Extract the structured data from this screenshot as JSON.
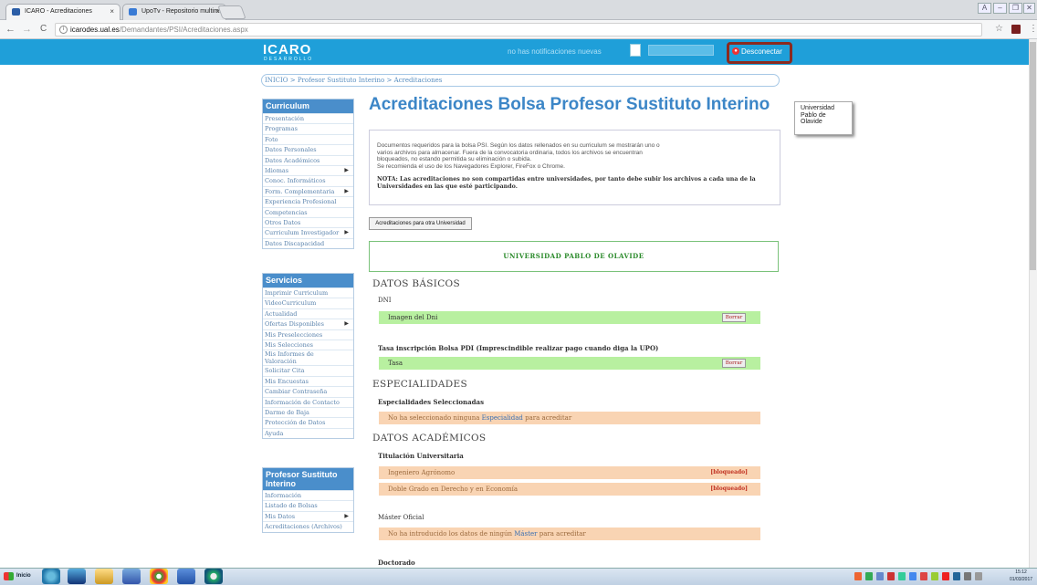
{
  "browser": {
    "tabs": [
      {
        "label": "ICARO - Acreditaciones",
        "close": "×",
        "fav_color": "#2b5ea7"
      },
      {
        "label": "UpoTv - Repositorio multim",
        "close": "×",
        "fav_color": "#3a7bd5"
      }
    ],
    "window_controls": [
      "A",
      "–",
      "❐",
      "✕"
    ],
    "nav": {
      "back": "←",
      "forward": "→",
      "reload": "C"
    },
    "address": {
      "host": "icarodes.ual.es",
      "path": "/Demandantes/PSI/Acreditaciones.aspx",
      "info": "i"
    },
    "star": "☆",
    "menu": "⋮"
  },
  "site": {
    "logo": "ICARO",
    "logo_sub": "DESARROLLO",
    "notifications": "no has notificaciones nuevas",
    "disconnect": "Desconectar",
    "brand_color": "#1f9fd9"
  },
  "breadcrumb": "INICIO > Profesor Sustituto Interino > Acreditaciones",
  "sidebar": {
    "curriculum": {
      "title": "Curriculum",
      "items": [
        {
          "label": "Presentación",
          "arrow": ""
        },
        {
          "label": "Programas",
          "arrow": ""
        },
        {
          "label": "Foto",
          "arrow": ""
        },
        {
          "label": "Datos Personales",
          "arrow": ""
        },
        {
          "label": "Datos Académicos",
          "arrow": ""
        },
        {
          "label": "Idiomas",
          "arrow": "▶"
        },
        {
          "label": "Conoc. Informáticos",
          "arrow": ""
        },
        {
          "label": "Form. Complementaria",
          "arrow": "▶"
        },
        {
          "label": "Experiencia Profesional",
          "arrow": ""
        },
        {
          "label": "Competencias",
          "arrow": ""
        },
        {
          "label": "Otros Datos",
          "arrow": ""
        },
        {
          "label": "Curriculum Investigador",
          "arrow": "▶"
        },
        {
          "label": "Datos Discapacidad",
          "arrow": ""
        }
      ]
    },
    "servicios": {
      "title": "Servicios",
      "items": [
        {
          "label": "Imprimir Curriculum",
          "arrow": ""
        },
        {
          "label": "VideoCurriculum",
          "arrow": ""
        },
        {
          "label": "Actualidad",
          "arrow": ""
        },
        {
          "label": "Ofertas Disponibles",
          "arrow": "▶"
        },
        {
          "label": "Mis Preselecciones",
          "arrow": ""
        },
        {
          "label": "Mis Selecciones",
          "arrow": ""
        },
        {
          "label": "Mis Informes de",
          "arrow": ""
        },
        {
          "label": "Valoración",
          "arrow": ""
        },
        {
          "label": "Solicitar Cita",
          "arrow": ""
        },
        {
          "label": "Mis Encuestas",
          "arrow": ""
        },
        {
          "label": "Cambiar Contraseña",
          "arrow": ""
        },
        {
          "label": "Información de Contacto",
          "arrow": ""
        },
        {
          "label": "Darme de Baja",
          "arrow": ""
        },
        {
          "label": "Protección de Datos",
          "arrow": ""
        },
        {
          "label": "Ayuda",
          "arrow": ""
        }
      ]
    },
    "psi": {
      "title_line1": "Profesor Sustituto",
      "title_line2": "Interino",
      "items": [
        {
          "label": "Información",
          "arrow": ""
        },
        {
          "label": "Listado de Bolsas",
          "arrow": ""
        },
        {
          "label": "Mis Datos",
          "arrow": "▶"
        },
        {
          "label": "Acreditaciones (Archivos)",
          "arrow": ""
        }
      ]
    }
  },
  "main": {
    "title": "Acreditaciones Bolsa Profesor Sustituto Interino",
    "university_card": {
      "line1": "Universidad",
      "line2": "Pablo de",
      "line3": "Olavide"
    },
    "description": {
      "line1": "Documentos requeridos para la bolsa PSI. Según los datos rellenados en su curriculum se mostrarán uno o",
      "line2": "varios archivos para almacenar. Fuera de la convocatoria ordinaria, todos los archivos se encuentran",
      "line3": "bloqueados, no estando permitida su eliminación o subida.",
      "line4": "Se recomienda el uso de los Navegadores Explorer, FireFox o Chrome.",
      "note": "NOTA: Las acreditaciones no son compartidas entre universidades, por tanto debe subir los archivos a cada una de la Universidades en las que esté participando."
    },
    "other_univ_button": "Acreditaciones para otra Universidad",
    "university_frame": "UNIVERSIDAD PABLO DE OLAVIDE",
    "datos_basicos": {
      "title": "DATOS BÁSICOS",
      "dni_label": "DNI",
      "dni_row": "Imagen del Dni",
      "dni_delete": "Borrar",
      "tasa_label": "Tasa inscripción Bolsa PDI (Imprescindible realizar pago cuando diga la UPO)",
      "tasa_row": "Tasa",
      "tasa_delete": "Borrar"
    },
    "especialidades": {
      "title": "ESPECIALIDADES",
      "label": "Especialidades Seleccionadas",
      "row_pre": "No ha seleccionado ninguna ",
      "row_link": "Especialidad",
      "row_post": " para acreditar"
    },
    "datos_academicos": {
      "title": "DATOS ACADÉMICOS",
      "titulacion_label": "Titulación Universitaria",
      "titulaciones": [
        {
          "name": "Ingeniero Agrónomo",
          "status": "[bloqueado]"
        },
        {
          "name": "Doble Grado en Derecho y en Economía",
          "status": "[bloqueado]"
        }
      ],
      "master_label": "Máster Oficial",
      "master_pre": "No ha introducido los datos de ningún ",
      "master_link": "Máster",
      "master_post": " para acreditar",
      "doctorado_label": "Doctorado"
    }
  },
  "taskbar": {
    "start": "Inicio",
    "clock_time": "15:12",
    "clock_date": "01/03/2017"
  }
}
